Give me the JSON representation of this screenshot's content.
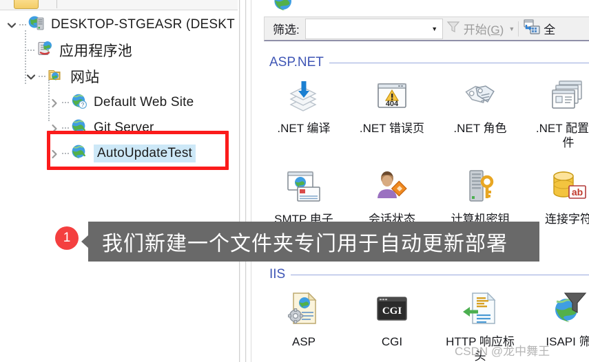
{
  "tree": {
    "nodes": [
      {
        "id": "server",
        "label": "DESKTOP-STGEASR (DESKT",
        "icon": "server-icon",
        "expander": "expanded",
        "indent": 0,
        "selected": false,
        "cjk": false
      },
      {
        "id": "apppools",
        "label": "应用程序池",
        "icon": "app-pools-icon",
        "expander": "none",
        "indent": 1,
        "selected": false,
        "cjk": true
      },
      {
        "id": "sites",
        "label": "网站",
        "icon": "sites-folder-icon",
        "expander": "expanded",
        "indent": 1,
        "selected": false,
        "cjk": true
      },
      {
        "id": "defaultweb",
        "label": "Default Web Site",
        "icon": "website-help-icon",
        "expander": "collapsed",
        "indent": 2,
        "selected": false,
        "cjk": false
      },
      {
        "id": "gitserver",
        "label": "Git Server",
        "icon": "website-icon",
        "expander": "collapsed",
        "indent": 2,
        "selected": false,
        "cjk": false
      },
      {
        "id": "autoupdatetest",
        "label": "AutoUpdateTest",
        "icon": "website-icon",
        "expander": "collapsed",
        "indent": 2,
        "selected": true,
        "cjk": false
      }
    ],
    "highlight_color": "#fb1b1b",
    "selection_color": "#cde8f7"
  },
  "toolbar": {
    "filter_label": "筛选:",
    "filter_value": "",
    "filter_placeholder": "",
    "dropdown_arrow_icon": "chevron-down-icon",
    "go_button": {
      "label_prefix": "开始(",
      "accel": "G",
      "label_suffix": ")",
      "icon": "funnel-icon"
    },
    "go_caret_icon": "chevron-down-icon",
    "show_all_button": {
      "label": "全",
      "icon": "show-all-icon"
    }
  },
  "features": {
    "sections": [
      {
        "id": "aspnet",
        "title": "ASP.NET",
        "rows": [
          [
            {
              "label": ".NET 编译",
              "icon": "net-compilation-icon"
            },
            {
              "label": ".NET 错误页",
              "icon": "net-error-pages-icon"
            },
            {
              "label": ".NET 角色",
              "icon": "net-roles-icon"
            },
            {
              "label": ".NET 配置文\n件",
              "icon": "net-profile-icon"
            }
          ],
          [
            {
              "label": "SMTP 电子",
              "icon": "smtp-email-icon"
            },
            {
              "label": "会话状态",
              "icon": "session-state-icon"
            },
            {
              "label": "计算机密钥",
              "icon": "machine-key-icon"
            },
            {
              "label": "连接字符",
              "icon": "connection-strings-icon"
            }
          ]
        ]
      },
      {
        "id": "iis",
        "title": "IIS",
        "rows": [
          [
            {
              "label": "ASP",
              "icon": "asp-icon"
            },
            {
              "label": "CGI",
              "icon": "cgi-icon"
            },
            {
              "label": "HTTP 响应标\n头",
              "icon": "http-response-headers-icon"
            },
            {
              "label": "ISAPI 筛",
              "icon": "isapi-filters-icon"
            }
          ]
        ]
      }
    ]
  },
  "callout": {
    "badge": "1",
    "text": "我们新建一个文件夹专门用于自动更新部署",
    "background_color": "#696969",
    "badge_color": "#f43f3f"
  },
  "watermark": {
    "text": "CSDN @龙中舞王"
  }
}
